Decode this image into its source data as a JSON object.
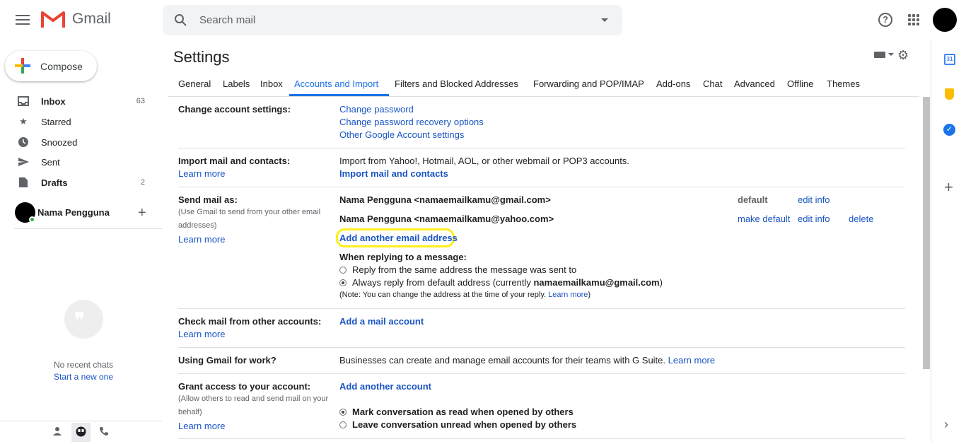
{
  "header": {
    "app_name": "Gmail",
    "search_placeholder": "Search mail",
    "help_glyph": "?"
  },
  "sidebar": {
    "compose_label": "Compose",
    "items": [
      {
        "label": "Inbox",
        "count": "63",
        "icon": "inbox-icon"
      },
      {
        "label": "Starred",
        "count": "",
        "icon": "star-icon"
      },
      {
        "label": "Snoozed",
        "count": "",
        "icon": "clock-icon"
      },
      {
        "label": "Sent",
        "count": "",
        "icon": "send-icon"
      },
      {
        "label": "Drafts",
        "count": "2",
        "icon": "draft-icon"
      }
    ],
    "profile_name": "Nama Pengguna",
    "no_chats": "No recent chats",
    "start_new": "Start a new one"
  },
  "main": {
    "title": "Settings",
    "tabs": [
      "General",
      "Labels",
      "Inbox",
      "Accounts and Import",
      "Filters and Blocked Addresses",
      "Forwarding and POP/IMAP",
      "Add-ons",
      "Chat",
      "Advanced",
      "Offline",
      "Themes"
    ],
    "active_tab": "Accounts and Import",
    "change_account": {
      "label": "Change account settings:",
      "links": [
        "Change password",
        "Change password recovery options",
        "Other Google Account settings"
      ]
    },
    "import": {
      "label": "Import mail and contacts:",
      "learn_more": "Learn more",
      "text": "Import from Yahoo!, Hotmail, AOL, or other webmail or POP3 accounts.",
      "action": "Import mail and contacts"
    },
    "send_as": {
      "label": "Send mail as:",
      "sub": "(Use Gmail to send from your other email addresses)",
      "learn_more": "Learn more",
      "accounts": [
        {
          "address": "Nama Pengguna <namaemailkamu@gmail.com>",
          "status": "default",
          "edit": "edit info"
        },
        {
          "address": "Nama Pengguna <namaemailkamu@yahoo.com>",
          "make_default": "make default",
          "edit": "edit info",
          "delete": "delete"
        }
      ],
      "add_another": "Add another email address",
      "reply_heading": "When replying to a message:",
      "reply_opt1": "Reply from the same address the message was sent to",
      "reply_opt2_pre": "Always reply from default address (currently ",
      "reply_opt2_email": "namaemailkamu@gmail.com",
      "reply_opt2_post": ")",
      "note_pre": "(Note: You can change the address at the time of your reply. ",
      "note_link": "Learn more",
      "note_post": ")"
    },
    "check_mail": {
      "label": "Check mail from other accounts:",
      "learn_more": "Learn more",
      "action": "Add a mail account"
    },
    "work": {
      "label": "Using Gmail for work?",
      "text": "Businesses can create and manage email accounts for their teams with G Suite.",
      "learn_more": "Learn more"
    },
    "grant": {
      "label": "Grant access to your account:",
      "sub": "(Allow others to read and send mail on your behalf)",
      "learn_more": "Learn more",
      "action": "Add another account",
      "opt1": "Mark conversation as read when opened by others",
      "opt2": "Leave conversation unread when opened by others"
    }
  },
  "right_panel": {
    "calendar_day": "31"
  }
}
